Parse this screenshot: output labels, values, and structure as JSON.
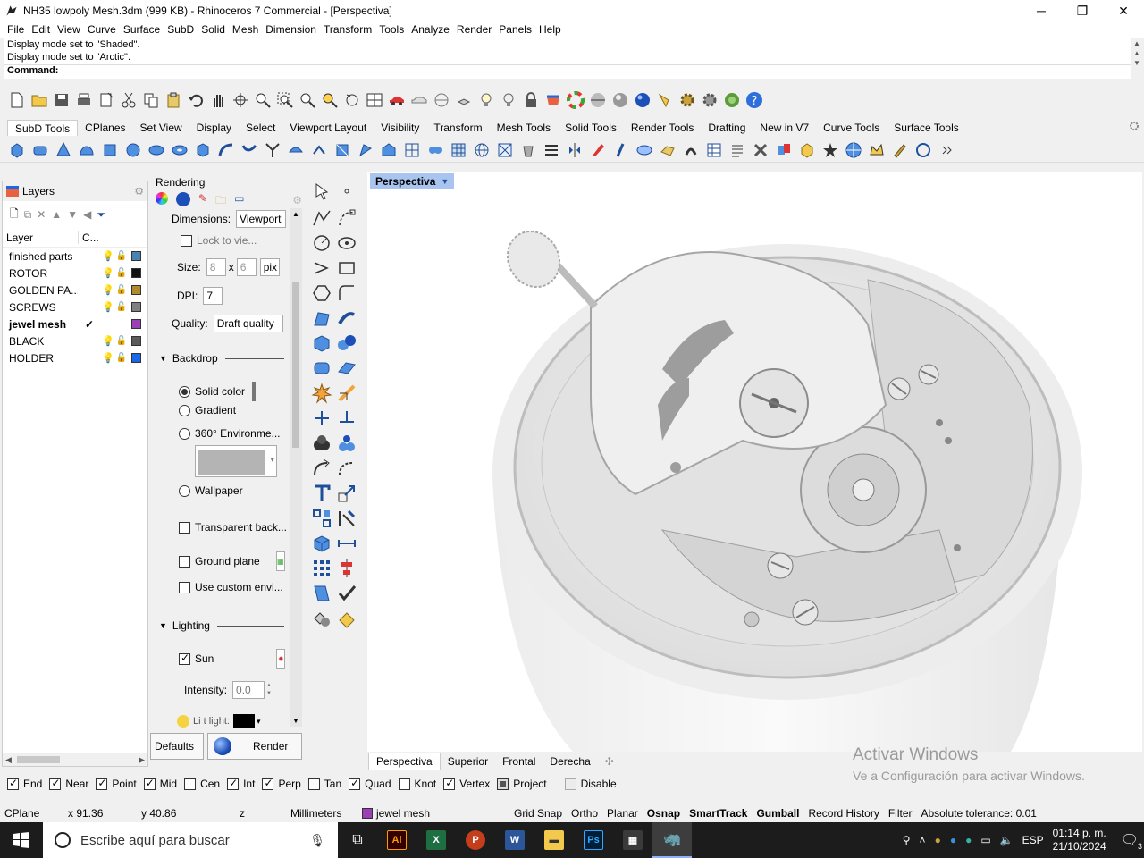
{
  "window": {
    "title": "NH35 lowpoly Mesh.3dm (999 KB) - Rhinoceros 7 Commercial - [Perspectiva]",
    "minimize": "─",
    "maximize": "❐",
    "close": "✕"
  },
  "menu": [
    "File",
    "Edit",
    "View",
    "Curve",
    "Surface",
    "SubD",
    "Solid",
    "Mesh",
    "Dimension",
    "Transform",
    "Tools",
    "Analyze",
    "Render",
    "Panels",
    "Help"
  ],
  "command": {
    "history": [
      "Display mode set to \"Shaded\".",
      "Display mode set to \"Arctic\"."
    ],
    "prompt": "Command:"
  },
  "toolbar_tabs": [
    "SubD Tools",
    "CPlanes",
    "Set View",
    "Display",
    "Select",
    "Viewport Layout",
    "Visibility",
    "Transform",
    "Mesh Tools",
    "Solid Tools",
    "Render Tools",
    "Drafting",
    "New in V7",
    "Curve Tools",
    "Surface Tools"
  ],
  "active_toolbar_tab": "SubD Tools",
  "layers": {
    "title": "Layers",
    "col_layer": "Layer",
    "col_c": "C...",
    "rows": [
      {
        "name": "finished parts",
        "current": "",
        "color": "#4a83b0"
      },
      {
        "name": "ROTOR",
        "current": "",
        "color": "#111111"
      },
      {
        "name": "GOLDEN PA...",
        "current": "",
        "color": "#b08a2e"
      },
      {
        "name": "SCREWS",
        "current": "",
        "color": "#808080"
      },
      {
        "name": "jewel mesh",
        "current": "✓",
        "color": "#9a3fb5"
      },
      {
        "name": "BLACK",
        "current": "",
        "color": "#5a5a5a"
      },
      {
        "name": "HOLDER",
        "current": "",
        "color": "#1769e8"
      }
    ]
  },
  "rendering": {
    "title": "Rendering",
    "dimensions_label": "Dimensions:",
    "dimensions_value": "Viewport",
    "lock_label": "Lock to vie...",
    "size_label": "Size:",
    "size_w": "8",
    "size_x": "x",
    "size_h": "6",
    "size_unit": "pix",
    "dpi_label": "DPI:",
    "dpi_value": "7",
    "quality_label": "Quality:",
    "quality_value": "Draft quality",
    "backdrop_label": "Backdrop",
    "solid_color": "Solid color",
    "gradient": "Gradient",
    "environment": "360° Environme...",
    "wallpaper": "Wallpaper",
    "transparent": "Transparent back...",
    "ground_plane": "Ground plane",
    "custom_env": "Use custom envi...",
    "lighting_label": "Lighting",
    "sun_label": "Sun",
    "intensity_label": "Intensity:",
    "intensity_value": "0.0",
    "light_label": "Li  t light:",
    "defaults_btn": "Defaults",
    "render_btn": "Render"
  },
  "viewport": {
    "title": "Perspectiva",
    "tabs": [
      "Perspectiva",
      "Superior",
      "Frontal",
      "Derecha"
    ],
    "active_tab": "Perspectiva"
  },
  "activate_windows": {
    "line1": "Activar Windows",
    "line2": "Ve a Configuración para activar Windows."
  },
  "osnaps": [
    {
      "label": "End",
      "on": true
    },
    {
      "label": "Near",
      "on": true
    },
    {
      "label": "Point",
      "on": true
    },
    {
      "label": "Mid",
      "on": true
    },
    {
      "label": "Cen",
      "on": false
    },
    {
      "label": "Int",
      "on": true
    },
    {
      "label": "Perp",
      "on": true
    },
    {
      "label": "Tan",
      "on": false
    },
    {
      "label": "Quad",
      "on": true
    },
    {
      "label": "Knot",
      "on": false
    },
    {
      "label": "Vertex",
      "on": true
    },
    {
      "label": "Project",
      "on": false
    },
    {
      "label": "Disable",
      "on": false
    }
  ],
  "status": {
    "cplane": "CPlane",
    "x": "x 91.36",
    "y": "y 40.86",
    "z": "z",
    "units": "Millimeters",
    "layer": "jewel mesh",
    "layer_color": "#9a3fb5",
    "grid_snap": "Grid Snap",
    "ortho": "Ortho",
    "planar": "Planar",
    "osnap": "Osnap",
    "smarttrack": "SmartTrack",
    "gumball": "Gumball",
    "record_history": "Record History",
    "filter": "Filter",
    "tolerance": "Absolute tolerance: 0.01"
  },
  "taskbar": {
    "search_placeholder": "Escribe aquí para buscar",
    "lang": "ESP",
    "time": "01:14 p. m.",
    "date": "21/10/2024",
    "notifications": "3"
  }
}
